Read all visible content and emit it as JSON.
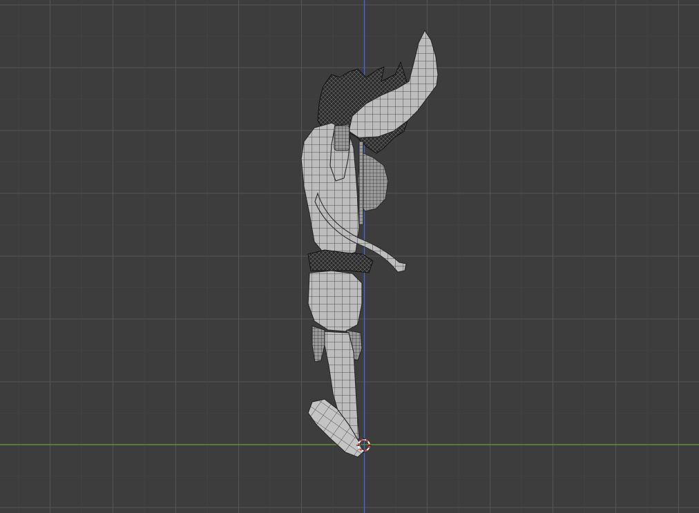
{
  "viewport": {
    "background_color": "#3d3d3d",
    "grid_minor_color": "#474747",
    "grid_major_color": "#555555",
    "x_axis_color": "#6b9e2f",
    "z_axis_color": "#3a6ed4",
    "mesh_fill_color": "#b8b8b8",
    "mesh_wire_color": "#2a2a2a",
    "hair_color": "#1e1e1e",
    "cursor_colors": [
      "#e03a3a",
      "#ffffff"
    ]
  },
  "icons": {
    "cursor": "3d-cursor-icon"
  }
}
